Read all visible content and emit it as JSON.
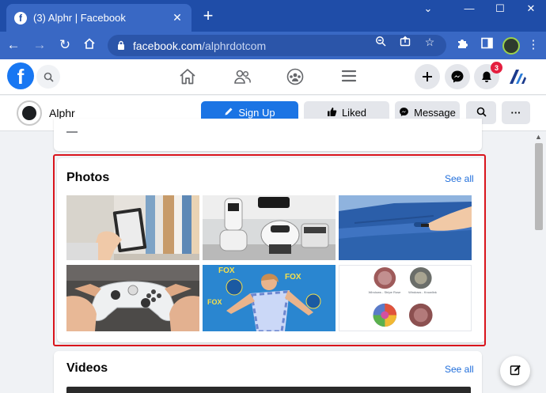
{
  "browser": {
    "tab_title": "(3) Alphr | Facebook",
    "tab_favicon": "f",
    "tab_close": "✕",
    "new_tab": "+",
    "minimize": "—",
    "maximize": "☐",
    "close": "✕",
    "url_domain": "facebook.com",
    "url_path": "/alphrdotcom",
    "accent": "#1f4da8"
  },
  "fbnav": {
    "logo": "f",
    "notification_count": "3",
    "brand_color": "#1877f2"
  },
  "page_header": {
    "name": "Alphr",
    "sign_up_label": "Sign Up",
    "liked_label": "Liked",
    "message_label": "Message",
    "more_label": "···"
  },
  "photos": {
    "title": "Photos",
    "see_all": "See all",
    "items": [
      {
        "icon": "photo-bookshelf-tablet"
      },
      {
        "icon": "photo-robots"
      },
      {
        "icon": "photo-car-door"
      },
      {
        "icon": "photo-xbox-controller"
      },
      {
        "icon": "photo-red-carpet"
      },
      {
        "icon": "photo-circle-patterns"
      }
    ],
    "pattern_captions": [
      "Windows - Stripe Rose",
      "Windows - Knowlink"
    ]
  },
  "videos": {
    "title": "Videos",
    "see_all": "See all"
  },
  "colors": {
    "highlight": "#d9141c",
    "link": "#216fdb",
    "primary_button": "#1b74e4"
  }
}
